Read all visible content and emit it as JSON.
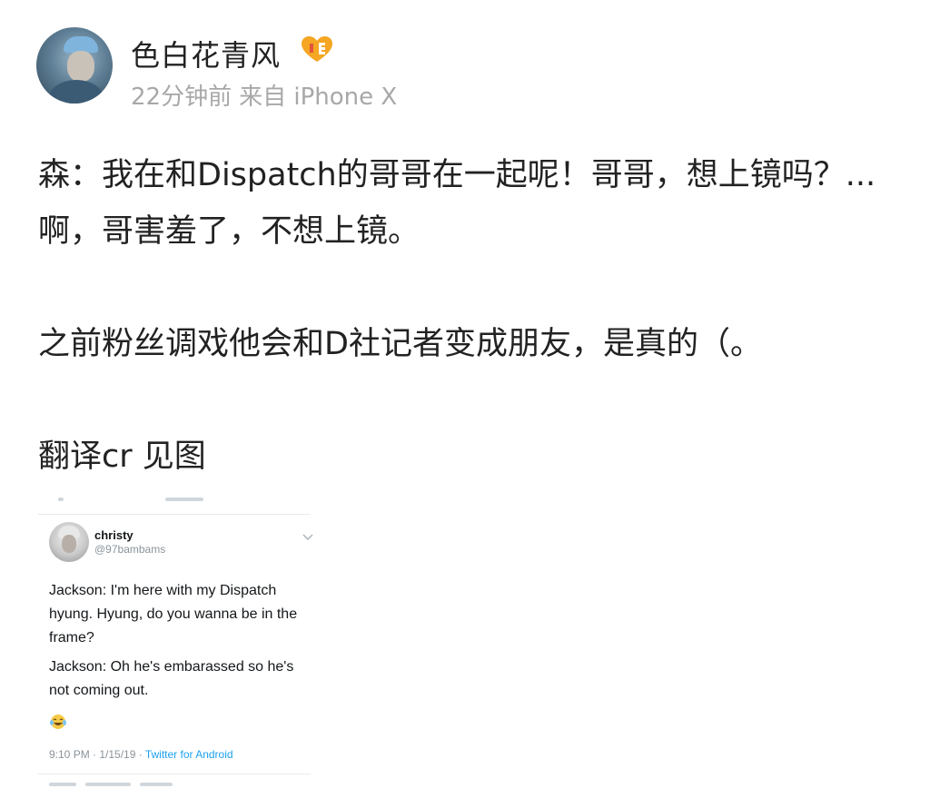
{
  "post": {
    "author": "色白花青风",
    "vip_badge_icon": "vip-heart-badge",
    "time_ago": "22分钟前",
    "source": "来自 iPhone X",
    "paragraphs": [
      "森：我在和Dispatch的哥哥在一起呢！哥哥，想上镜吗？...啊，哥害羞了，不想上镜。",
      "之前粉丝调戏他会和D社记者变成朋友，是真的（。",
      "翻译cr 见图"
    ]
  },
  "tweet": {
    "name": "christy",
    "handle": "@97bambams",
    "body": [
      "Jackson: I'm here with my Dispatch hyung. Hyung, do you wanna be in the frame?",
      "Jackson: Oh he's embarassed so he's not coming out."
    ],
    "emoji_icon": "face-with-tears-of-joy-icon",
    "timestamp": "9:10 PM · 1/15/19 · ",
    "client": "Twitter for Android"
  },
  "colors": {
    "text": "#222222",
    "meta": "#a8a8a8",
    "link": "#1da1f2",
    "badge": "#f5a623"
  }
}
